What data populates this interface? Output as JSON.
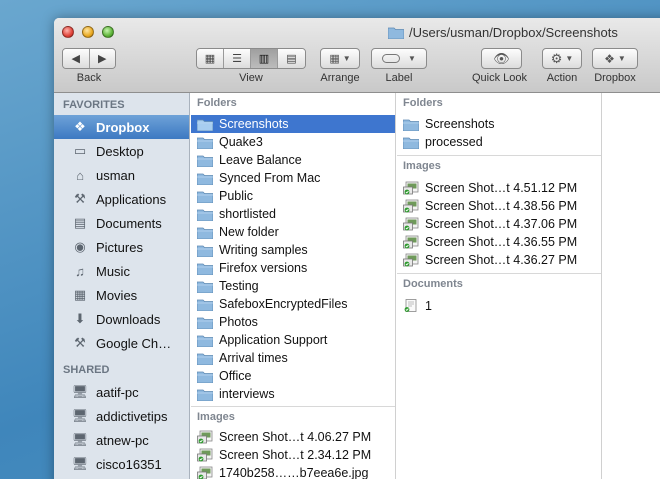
{
  "window": {
    "path_title": "/Users/usman/Dropbox/Screenshots"
  },
  "toolbar": {
    "back_label": "Back",
    "view_label": "View",
    "arrange_label": "Arrange",
    "label_label": "Label",
    "quicklook_label": "Quick Look",
    "action_label": "Action",
    "dropbox_label": "Dropbox"
  },
  "sidebar": {
    "favorites_heading": "FAVORITES",
    "favorites": [
      {
        "label": "Dropbox",
        "icon": "dropbox-icon"
      },
      {
        "label": "Desktop",
        "icon": "desktop-icon"
      },
      {
        "label": "usman",
        "icon": "home-icon"
      },
      {
        "label": "Applications",
        "icon": "applications-icon"
      },
      {
        "label": "Documents",
        "icon": "documents-icon"
      },
      {
        "label": "Pictures",
        "icon": "camera-icon"
      },
      {
        "label": "Music",
        "icon": "music-icon"
      },
      {
        "label": "Movies",
        "icon": "film-icon"
      },
      {
        "label": "Downloads",
        "icon": "download-icon"
      },
      {
        "label": "Google Ch…",
        "icon": "applications-icon"
      }
    ],
    "shared_heading": "SHARED",
    "shared": [
      {
        "label": "aatif-pc",
        "icon": "computer-icon"
      },
      {
        "label": "addictivetips",
        "icon": "computer-icon"
      },
      {
        "label": "atnew-pc",
        "icon": "computer-icon"
      },
      {
        "label": "cisco16351",
        "icon": "computer-icon"
      }
    ]
  },
  "column1": {
    "folders_heading": "Folders",
    "folders": [
      "Screenshots",
      "Quake3",
      "Leave Balance",
      "Synced From Mac",
      "Public",
      "shortlisted",
      "New folder",
      "Writing samples",
      "Firefox versions",
      "Testing",
      "SafeboxEncryptedFiles",
      "Photos",
      "Application Support",
      "Arrival times",
      "Office",
      "interviews"
    ],
    "images_heading": "Images",
    "images": [
      "Screen Shot…t 4.06.27 PM",
      "Screen Shot…t 2.34.12 PM",
      "1740b258……b7eea6e.jpg"
    ]
  },
  "column2": {
    "folders_heading": "Folders",
    "folders": [
      "Screenshots",
      "processed"
    ],
    "images_heading": "Images",
    "images": [
      "Screen Shot…t 4.51.12 PM",
      "Screen Shot…t 4.38.56 PM",
      "Screen Shot…t 4.37.06 PM",
      "Screen Shot…t 4.36.55 PM",
      "Screen Shot…t 4.36.27 PM"
    ],
    "documents_heading": "Documents",
    "documents": [
      "1"
    ]
  },
  "colors": {
    "selection": "#3e76cf",
    "sidebar_bg": "#dde4ec",
    "folder": "#8fb9df"
  }
}
